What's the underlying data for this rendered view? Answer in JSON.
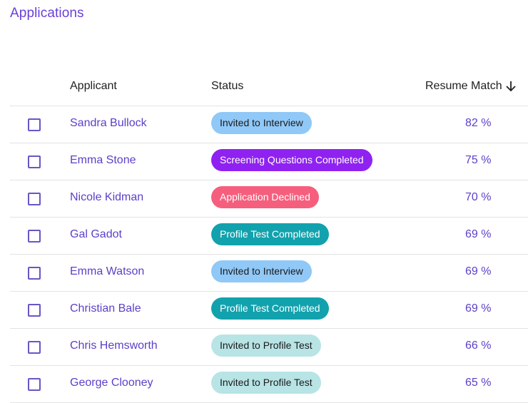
{
  "page": {
    "title": "Applications"
  },
  "table": {
    "headers": {
      "applicant": "Applicant",
      "status": "Status",
      "resume_match": "Resume Match",
      "sort_icon": "arrow-down-icon"
    },
    "rows": [
      {
        "name": "Sandra Bullock",
        "status": "Invited to Interview",
        "status_kind": "invited-interview",
        "match": "82 %"
      },
      {
        "name": "Emma Stone",
        "status": "Screening Questions Completed",
        "status_kind": "screening",
        "match": "75 %"
      },
      {
        "name": "Nicole Kidman",
        "status": "Application Declined",
        "status_kind": "declined",
        "match": "70 %"
      },
      {
        "name": "Gal Gadot",
        "status": "Profile Test Completed",
        "status_kind": "profile-completed",
        "match": "69 %"
      },
      {
        "name": "Emma Watson",
        "status": "Invited to Interview",
        "status_kind": "invited-interview",
        "match": "69 %"
      },
      {
        "name": "Christian Bale",
        "status": "Profile Test Completed",
        "status_kind": "profile-completed",
        "match": "69 %"
      },
      {
        "name": "Chris Hemsworth",
        "status": "Invited to Profile Test",
        "status_kind": "invited-profile",
        "match": "66 %"
      },
      {
        "name": "George Clooney",
        "status": "Invited to Profile Test",
        "status_kind": "invited-profile",
        "match": "65 %"
      }
    ]
  },
  "colors": {
    "accent": "#6a3fd8",
    "link": "#5d3fc9",
    "invited_interview": "#90c8f7",
    "screening": "#8f22f0",
    "declined": "#f55f7d",
    "profile_completed": "#12a2ad",
    "invited_profile": "#b8e4e6"
  }
}
